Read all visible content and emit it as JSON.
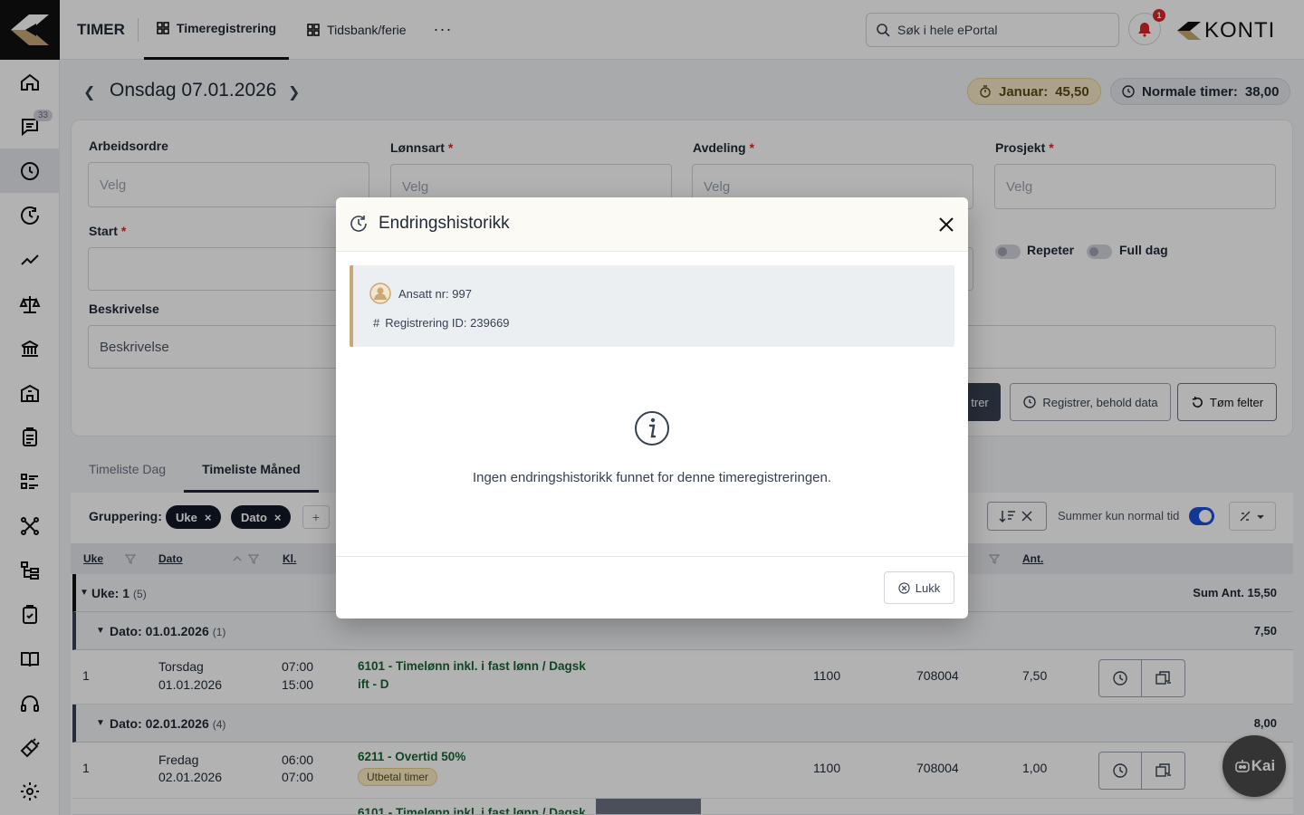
{
  "topbar": {
    "app_title": "TIMER",
    "tabs": [
      {
        "label": "Timeregistrering",
        "active": true
      },
      {
        "label": "Tidsbank/ferie",
        "active": false
      }
    ],
    "more": "···",
    "search_placeholder": "Søk i hele ePortal",
    "notification_count": "1",
    "brand": "KONTI"
  },
  "sidebar": {
    "items": [
      {
        "icon": "home-icon"
      },
      {
        "icon": "chat-icon",
        "badge": "33"
      },
      {
        "icon": "clock-icon",
        "active": true
      },
      {
        "icon": "clock-history-icon"
      },
      {
        "icon": "trend-icon"
      },
      {
        "icon": "scale-icon"
      },
      {
        "icon": "bank-icon"
      },
      {
        "icon": "building-icon"
      },
      {
        "icon": "clipboard-icon"
      },
      {
        "icon": "list-icon"
      },
      {
        "icon": "network-icon"
      },
      {
        "icon": "tree-icon"
      },
      {
        "icon": "clipboard-check-icon"
      },
      {
        "icon": "book-icon"
      },
      {
        "icon": "headset-icon"
      },
      {
        "icon": "plug-icon"
      },
      {
        "icon": "settings-icon"
      }
    ]
  },
  "date_bar": {
    "title": "Onsdag 07.01.2026",
    "month_label": "Januar:",
    "month_value": "45,50",
    "normal_label": "Normale timer:",
    "normal_value": "38,00"
  },
  "form": {
    "arbeidsordre": {
      "label": "Arbeidsordre",
      "placeholder": "Velg"
    },
    "lonnsart": {
      "label": "Lønnsart",
      "placeholder": "Velg"
    },
    "avdeling": {
      "label": "Avdeling",
      "placeholder": "Velg"
    },
    "prosjekt": {
      "label": "Prosjekt",
      "placeholder": "Velg"
    },
    "start": {
      "label": "Start"
    },
    "beskrivelse": {
      "label": "Beskrivelse",
      "placeholder": "Beskrivelse"
    },
    "repeter": "Repeter",
    "full_dag": "Full dag",
    "register_partial": "trer",
    "register_keep": "Registrer, behold data",
    "clear": "Tøm felter"
  },
  "lower_tabs": [
    {
      "label": "Timeliste Dag",
      "active": false
    },
    {
      "label": "Timeliste Måned",
      "active": true
    }
  ],
  "grouping": {
    "label": "Gruppering:",
    "chips": [
      "Uke",
      "Dato"
    ],
    "add": "+",
    "sum_normal": "Summer kun normal tid"
  },
  "columns": {
    "uke": "Uke",
    "dato": "Dato",
    "kl": "Kl.",
    "ant": "Ant."
  },
  "week_group": {
    "label": "Uke:",
    "value": "1",
    "count": "(5)",
    "sum": "Sum Ant. 15,50"
  },
  "date_groups": [
    {
      "label": "Dato:",
      "value": "01.01.2026",
      "count": "(1)",
      "sum": "7,50"
    },
    {
      "label": "Dato:",
      "value": "02.01.2026",
      "count": "(4)",
      "sum": "8,00"
    }
  ],
  "rows": [
    {
      "uke": "1",
      "day": "Torsdag",
      "date": "01.01.2026",
      "from": "07:00",
      "to": "15:00",
      "lonn_line1": "6101 - Timelønn inkl. i fast lønn / Dagsk",
      "lonn_line2": "ift - D",
      "tag": "",
      "avd": "1100",
      "prosjekt": "708004",
      "ant": "7,50"
    },
    {
      "uke": "1",
      "day": "Fredag",
      "date": "02.01.2026",
      "from": "06:00",
      "to": "07:00",
      "lonn_line1": "6211 - Overtid 50%",
      "lonn_line2": "",
      "tag": "Utbetal timer",
      "avd": "1100",
      "prosjekt": "708004",
      "ant": "1,00"
    }
  ],
  "partial_row": {
    "lonn_line1": "6101 - Timelønn inkl. i fast lønn / Dagsk"
  },
  "kai": {
    "label": "Kai"
  },
  "modal": {
    "title": "Endringshistorikk",
    "employee": "Ansatt nr: 997",
    "registration_prefix": "#",
    "registration": "Registrering ID: 239669",
    "empty_text": "Ingen endringshistorikk funnet for denne timeregistreringen.",
    "close_label": "Lukk"
  },
  "colors": {
    "accent_gold": "#c8a875",
    "switch_blue": "#1d4ed8",
    "badge_red": "#dc2626",
    "lonn_green": "#166534"
  }
}
